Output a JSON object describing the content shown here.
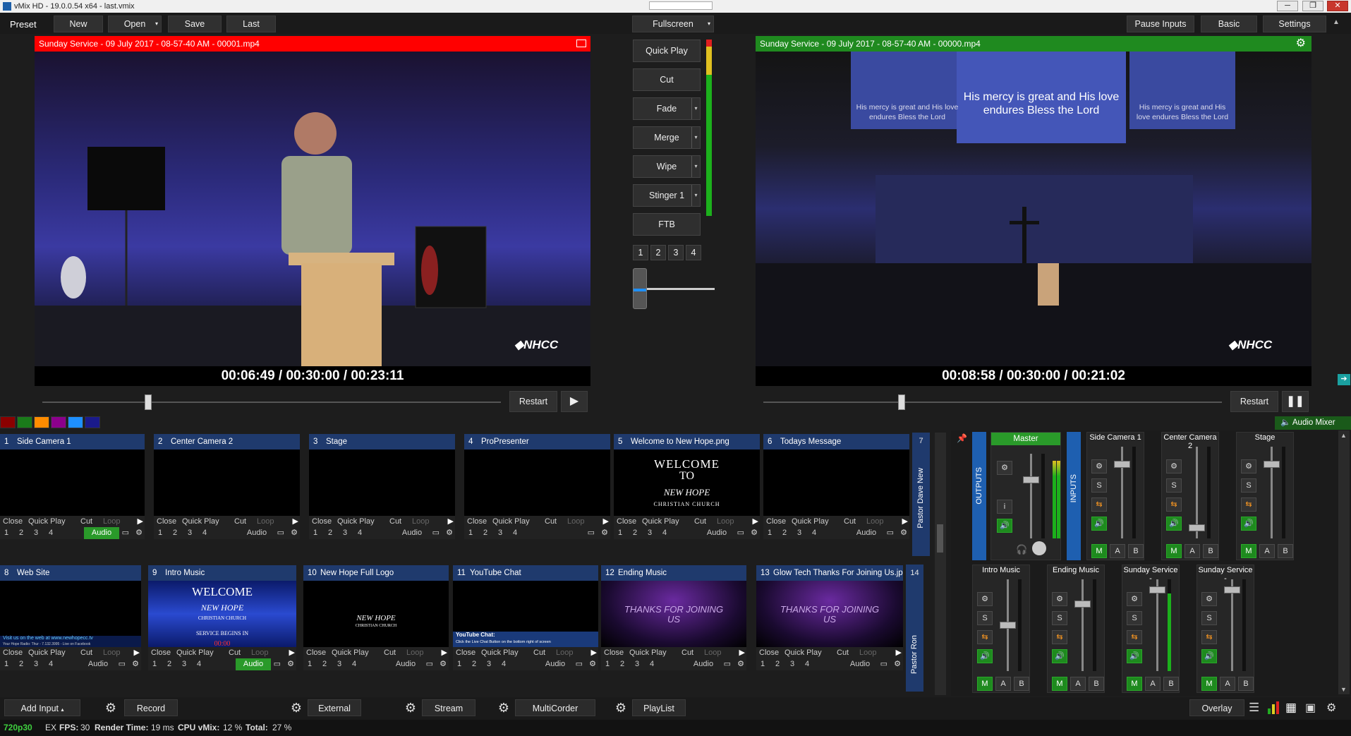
{
  "window": {
    "title": "vMix HD - 19.0.0.54 x64 - last.vmix"
  },
  "topbar": {
    "preset": "Preset",
    "new": "New",
    "open": "Open",
    "save": "Save",
    "last": "Last",
    "fullscreen": "Fullscreen",
    "pause_inputs": "Pause Inputs",
    "basic": "Basic",
    "settings": "Settings"
  },
  "preview": {
    "title": "Sunday Service - 09 July 2017 - 08-57-40 AM - 00001.mp4",
    "timecode": "00:06:49  /  00:30:00  /  00:23:11",
    "restart": "Restart",
    "bar_color": "#ff0000",
    "logo": "NHCC"
  },
  "output": {
    "title": "Sunday Service - 09 July 2017 - 08-57-40 AM - 00000.mp4",
    "timecode": "00:08:58  /  00:30:00  /  00:21:02",
    "restart": "Restart",
    "bar_color": "#1f8a1f",
    "logo": "NHCC",
    "screen_text_center": "His mercy is great and His love endures Bless the Lord",
    "screen_text_side": "His mercy is great and His love endures Bless the Lord"
  },
  "transitions": {
    "buttons": [
      "Quick Play",
      "Cut",
      "Fade",
      "Merge",
      "Wipe",
      "Stinger 1",
      "FTB"
    ],
    "pages": [
      "1",
      "2",
      "3",
      "4"
    ]
  },
  "color_swatches": [
    "#8b0000",
    "#1a7a1a",
    "#ff8c00",
    "#8b008b",
    "#1e90ff",
    "#1a1a8b"
  ],
  "audio_mixer_label": "Audio Mixer",
  "inputs_row1": [
    {
      "num": "1",
      "name": "Side Camera 1",
      "ctrl": [
        "Close",
        "Quick Play",
        "Cut",
        "Loop"
      ],
      "audio": "Audio",
      "audio_on": true
    },
    {
      "num": "2",
      "name": "Center Camera 2",
      "ctrl": [
        "Close",
        "Quick Play",
        "Cut",
        "Loop"
      ],
      "audio": "Audio",
      "audio_on": false
    },
    {
      "num": "3",
      "name": "Stage",
      "ctrl": [
        "Close",
        "Quick Play",
        "Cut",
        "Loop"
      ],
      "audio": "Audio",
      "audio_on": false
    },
    {
      "num": "4",
      "name": "ProPresenter",
      "ctrl": [
        "Close",
        "Quick Play",
        "Cut",
        "Loop"
      ],
      "audio": "",
      "audio_on": false
    },
    {
      "num": "5",
      "name": "Welcome to New Hope.png",
      "ctrl": [
        "Close",
        "Quick Play",
        "Cut",
        "Loop"
      ],
      "audio": "Audio",
      "audio_on": false
    },
    {
      "num": "6",
      "name": "Todays Message",
      "ctrl": [
        "Close",
        "Quick Play",
        "Cut",
        "Loop"
      ],
      "audio": "Audio",
      "audio_on": false
    }
  ],
  "inputs_row2": [
    {
      "num": "8",
      "name": "Web Site",
      "ctrl": [
        "Close",
        "Quick Play",
        "Cut",
        "Loop"
      ],
      "audio": "Audio",
      "audio_on": false
    },
    {
      "num": "9",
      "name": "Intro Music",
      "ctrl": [
        "Close",
        "Quick Play",
        "Cut",
        "Loop"
      ],
      "audio": "Audio",
      "audio_on": true
    },
    {
      "num": "10",
      "name": "New Hope Full Logo",
      "ctrl": [
        "Close",
        "Quick Play",
        "Cut",
        "Loop"
      ],
      "audio": "Audio",
      "audio_on": false
    },
    {
      "num": "11",
      "name": "YouTube Chat",
      "ctrl": [
        "Close",
        "Quick Play",
        "Cut",
        "Loop"
      ],
      "audio": "Audio",
      "audio_on": false
    },
    {
      "num": "12",
      "name": "Ending Music",
      "ctrl": [
        "Close",
        "Quick Play",
        "Cut",
        "Loop"
      ],
      "audio": "Audio",
      "audio_on": false
    },
    {
      "num": "13",
      "name": "Glow Tech Thanks For Joining Us.jpg",
      "ctrl": [
        "Close",
        "Quick Play",
        "Cut",
        "Loop"
      ],
      "audio": "Audio",
      "audio_on": false
    }
  ],
  "page_nums": [
    "1",
    "2",
    "3",
    "4"
  ],
  "side_tabs": {
    "tab7": "7",
    "tab7_label": "Pastor Dave New",
    "tab14": "14",
    "tab14_label": "Pastor Ron"
  },
  "thumbs": {
    "welcome_l1": "WELCOME",
    "welcome_l2": "TO",
    "welcome_l3": "NEW HOPE",
    "welcome_l4": "CHRISTIAN CHURCH",
    "intro_l1": "WELCOME",
    "intro_l2": "NEW HOPE",
    "intro_l3": "CHRISTIAN CHURCH",
    "intro_l4": "SERVICE BEGINS IN",
    "intro_l5": "00:00",
    "logo_l1": "NEW HOPE",
    "logo_l2": "CHRISTIAN CHURCH",
    "web_l1": "Visit us on the web at www.newhopecc.tv",
    "web_l2": "Your Hope Radio: Thur - 7.132.3995 - Live on Facebook",
    "chat_l1": "YouTube Chat:",
    "chat_l2": "Click the Live Chat Button on the bottom right of screen",
    "thanks": "THANKS FOR JOINING US"
  },
  "mixer": {
    "outputs": "OUTPUTS",
    "inputs": "INPUTS",
    "master": "Master",
    "top_channels": [
      "Side Camera 1",
      "Center Camera 2",
      "Stage"
    ],
    "bottom_channels": [
      "Intro Music",
      "Ending Music",
      "Sunday Service -",
      "Sunday Service -"
    ],
    "m": "M",
    "a": "A",
    "b": "B",
    "s": "S",
    "i": "i"
  },
  "bottombar": {
    "add_input": "Add Input",
    "record": "Record",
    "external": "External",
    "stream": "Stream",
    "multicorder": "MultiCorder",
    "playlist": "PlayList",
    "overlay": "Overlay"
  },
  "status": {
    "resolution": "720p30",
    "ex": "EX",
    "fps_label": "FPS:",
    "fps": "30",
    "render_label": "Render Time:",
    "render": "19 ms",
    "cpu_label": "CPU vMix:",
    "cpu": "12 %",
    "total_label": "Total:",
    "total": "27 %"
  }
}
